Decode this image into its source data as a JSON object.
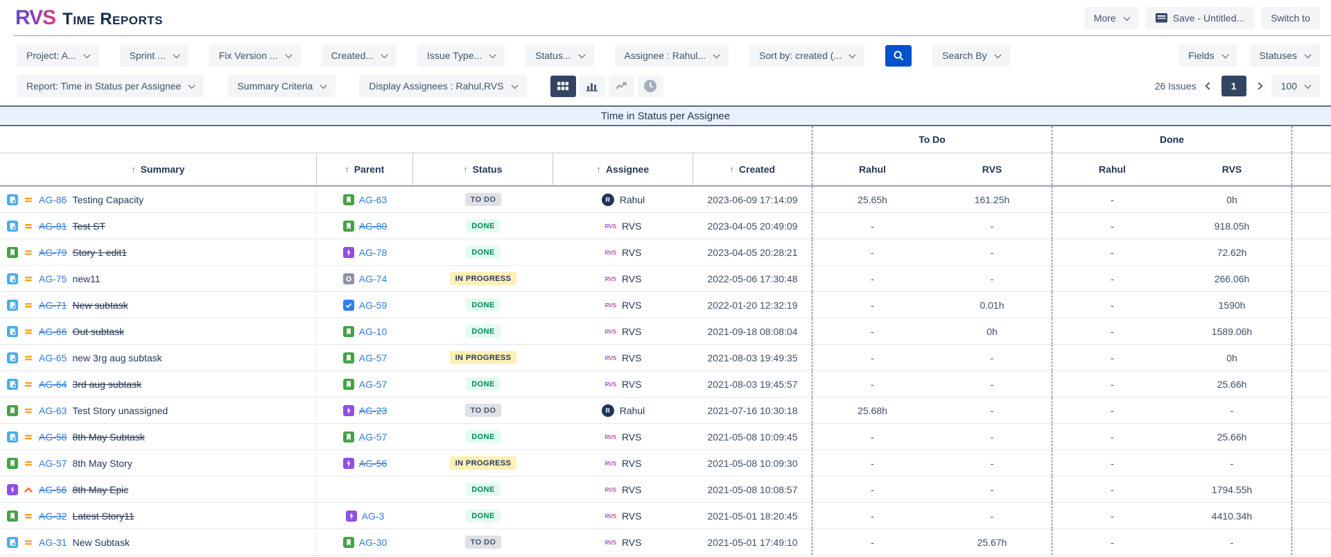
{
  "brand": {
    "logo": "RVS",
    "app_title": "Time Reports"
  },
  "top_actions": {
    "more": "More",
    "save": "Save - Untitled...",
    "switch_to": "Switch to"
  },
  "filter_row1": {
    "dropdowns": [
      {
        "name": "project",
        "label": "Project: A..."
      },
      {
        "name": "sprint",
        "label": "Sprint ..."
      },
      {
        "name": "fix-version",
        "label": "Fix Version ..."
      },
      {
        "name": "created",
        "label": "Created..."
      },
      {
        "name": "issue-type",
        "label": "Issue Type..."
      },
      {
        "name": "status",
        "label": "Status..."
      },
      {
        "name": "assignee",
        "label": "Assignee : Rahul..."
      },
      {
        "name": "sort-by",
        "label": "Sort by: created (..."
      }
    ],
    "search_icon": "search-icon",
    "search_by_label": "Search By",
    "right_dropdowns": [
      {
        "name": "fields",
        "label": "Fields"
      },
      {
        "name": "statuses",
        "label": "Statuses"
      }
    ]
  },
  "filter_row2": {
    "dropdowns": [
      {
        "name": "report",
        "label": "Report: Time in Status per Assignee"
      },
      {
        "name": "summary-criteria",
        "label": "Summary Criteria"
      },
      {
        "name": "display-assignees",
        "label": "Display Assignees : Rahul,RVS"
      }
    ],
    "views": [
      {
        "name": "table-view",
        "icon": "grid-icon",
        "selected": true
      },
      {
        "name": "bar-chart-view",
        "icon": "bar-chart-icon",
        "selected": false
      },
      {
        "name": "line-chart-view",
        "icon": "line-chart-icon",
        "selected": false
      },
      {
        "name": "time-view",
        "icon": "clock-icon",
        "selected": false
      }
    ],
    "issues_count": "26 Issues",
    "page": "1",
    "page_size": "100"
  },
  "report": {
    "title": "Time in Status per Assignee",
    "group_headers": [
      "To Do",
      "Done"
    ],
    "columns": [
      {
        "label": "Summary",
        "sortable": true
      },
      {
        "label": "Parent",
        "sortable": true
      },
      {
        "label": "Status",
        "sortable": true
      },
      {
        "label": "Assignee",
        "sortable": true
      },
      {
        "label": "Created",
        "sortable": true
      }
    ],
    "value_columns": [
      "Rahul",
      "RVS",
      "Rahul",
      "RVS"
    ],
    "rows": [
      {
        "type": "subtask",
        "priority": "medium",
        "key": "AG-86",
        "resolved": false,
        "summary": "Testing Capacity",
        "parent": {
          "type": "story",
          "key": "AG-63",
          "resolved": false
        },
        "status": "TO DO",
        "status_kind": "todo",
        "assignee": "Rahul",
        "assignee_kind": "user",
        "created": "2023-06-09 17:14:09",
        "values": [
          "25.65h",
          "161.25h",
          "-",
          "0h"
        ]
      },
      {
        "type": "subtask",
        "priority": "medium",
        "key": "AG-81",
        "resolved": true,
        "summary": "Test ST",
        "parent": {
          "type": "story",
          "key": "AG-80",
          "resolved": true
        },
        "status": "DONE",
        "status_kind": "done",
        "assignee": "RVS",
        "assignee_kind": "rvs",
        "created": "2023-04-05 20:49:09",
        "values": [
          "-",
          "-",
          "-",
          "918.05h"
        ]
      },
      {
        "type": "story",
        "priority": "medium",
        "key": "AG-79",
        "resolved": true,
        "summary": "Story 1 edit1",
        "parent": {
          "type": "epic",
          "key": "AG-78",
          "resolved": false
        },
        "status": "DONE",
        "status_kind": "done",
        "assignee": "RVS",
        "assignee_kind": "rvs",
        "created": "2023-04-05 20:28:21",
        "values": [
          "-",
          "-",
          "-",
          "72.62h"
        ]
      },
      {
        "type": "subtask",
        "priority": "medium",
        "key": "AG-75",
        "resolved": false,
        "summary": "new11",
        "parent": {
          "type": "change",
          "key": "AG-74",
          "resolved": false
        },
        "status": "IN PROGRESS",
        "status_kind": "inprogress",
        "assignee": "RVS",
        "assignee_kind": "rvs",
        "created": "2022-05-06 17:30:48",
        "values": [
          "-",
          "-",
          "-",
          "266.06h"
        ]
      },
      {
        "type": "subtask",
        "priority": "medium",
        "key": "AG-71",
        "resolved": true,
        "summary": "New subtask",
        "parent": {
          "type": "task",
          "key": "AG-59",
          "resolved": false
        },
        "status": "DONE",
        "status_kind": "done",
        "assignee": "RVS",
        "assignee_kind": "rvs",
        "created": "2022-01-20 12:32:19",
        "values": [
          "-",
          "0.01h",
          "-",
          "1590h"
        ]
      },
      {
        "type": "subtask",
        "priority": "medium",
        "key": "AG-66",
        "resolved": true,
        "summary": "Out subtask",
        "parent": {
          "type": "story",
          "key": "AG-10",
          "resolved": false
        },
        "status": "DONE",
        "status_kind": "done",
        "assignee": "RVS",
        "assignee_kind": "rvs",
        "created": "2021-09-18 08:08:04",
        "values": [
          "-",
          "0h",
          "-",
          "1589.06h"
        ]
      },
      {
        "type": "subtask",
        "priority": "medium",
        "key": "AG-65",
        "resolved": false,
        "summary": "new 3rg aug subtask",
        "parent": {
          "type": "story",
          "key": "AG-57",
          "resolved": false
        },
        "status": "IN PROGRESS",
        "status_kind": "inprogress",
        "assignee": "RVS",
        "assignee_kind": "rvs",
        "created": "2021-08-03 19:49:35",
        "values": [
          "-",
          "-",
          "-",
          "0h"
        ]
      },
      {
        "type": "subtask",
        "priority": "medium",
        "key": "AG-64",
        "resolved": true,
        "summary": "3rd aug subtask",
        "parent": {
          "type": "story",
          "key": "AG-57",
          "resolved": false
        },
        "status": "DONE",
        "status_kind": "done",
        "assignee": "RVS",
        "assignee_kind": "rvs",
        "created": "2021-08-03 19:45:57",
        "values": [
          "-",
          "-",
          "-",
          "25.66h"
        ]
      },
      {
        "type": "story",
        "priority": "medium",
        "key": "AG-63",
        "resolved": false,
        "summary": "Test Story unassigned",
        "parent": {
          "type": "epic",
          "key": "AG-23",
          "resolved": true
        },
        "status": "TO DO",
        "status_kind": "todo",
        "assignee": "Rahul",
        "assignee_kind": "user",
        "created": "2021-07-16 10:30:18",
        "values": [
          "25.68h",
          "-",
          "-",
          "-"
        ]
      },
      {
        "type": "subtask",
        "priority": "medium",
        "key": "AG-58",
        "resolved": true,
        "summary": "8th May Subtask",
        "parent": {
          "type": "story",
          "key": "AG-57",
          "resolved": false
        },
        "status": "DONE",
        "status_kind": "done",
        "assignee": "RVS",
        "assignee_kind": "rvs",
        "created": "2021-05-08 10:09:45",
        "values": [
          "-",
          "-",
          "-",
          "25.66h"
        ]
      },
      {
        "type": "story",
        "priority": "medium",
        "key": "AG-57",
        "resolved": false,
        "summary": "8th May Story",
        "parent": {
          "type": "epic",
          "key": "AG-56",
          "resolved": true
        },
        "status": "IN PROGRESS",
        "status_kind": "inprogress",
        "assignee": "RVS",
        "assignee_kind": "rvs",
        "created": "2021-05-08 10:09:30",
        "values": [
          "-",
          "-",
          "-",
          "-"
        ]
      },
      {
        "type": "epic",
        "priority": "high",
        "key": "AG-56",
        "resolved": true,
        "summary": "8th May Epic",
        "parent": null,
        "status": "DONE",
        "status_kind": "done",
        "assignee": "RVS",
        "assignee_kind": "rvs",
        "created": "2021-05-08 10:08:57",
        "values": [
          "-",
          "-",
          "-",
          "1794.55h"
        ]
      },
      {
        "type": "story",
        "priority": "medium",
        "key": "AG-32",
        "resolved": true,
        "summary": "Latest Story11",
        "parent": {
          "type": "epic",
          "key": "AG-3",
          "resolved": false
        },
        "status": "DONE",
        "status_kind": "done",
        "assignee": "RVS",
        "assignee_kind": "rvs",
        "created": "2021-05-01 18:20:45",
        "values": [
          "-",
          "-",
          "-",
          "4410.34h"
        ]
      },
      {
        "type": "subtask",
        "priority": "medium",
        "key": "AG-31",
        "resolved": false,
        "summary": "New Subtask",
        "parent": {
          "type": "story",
          "key": "AG-30",
          "resolved": false
        },
        "status": "TO DO",
        "status_kind": "todo",
        "assignee": "RVS",
        "assignee_kind": "rvs",
        "created": "2021-05-01 17:49:10",
        "values": [
          "-",
          "25.67h",
          "-",
          "-"
        ]
      }
    ]
  },
  "colors": {
    "primary_blue": "#0052cc",
    "selected_view_bg": "#344563",
    "brand_gradient_from": "#5a4fcf",
    "brand_gradient_to": "#e03a7d",
    "status_todo_bg": "#dfe1e6",
    "status_done_bg": "#e3fcef",
    "status_done_text": "#00875a",
    "status_inprogress_bg": "#fff0b3",
    "link_blue": "#2e7bdc",
    "title_bar_bg": "#e9f2fc",
    "dashed_divider": "#3d5fa5"
  }
}
